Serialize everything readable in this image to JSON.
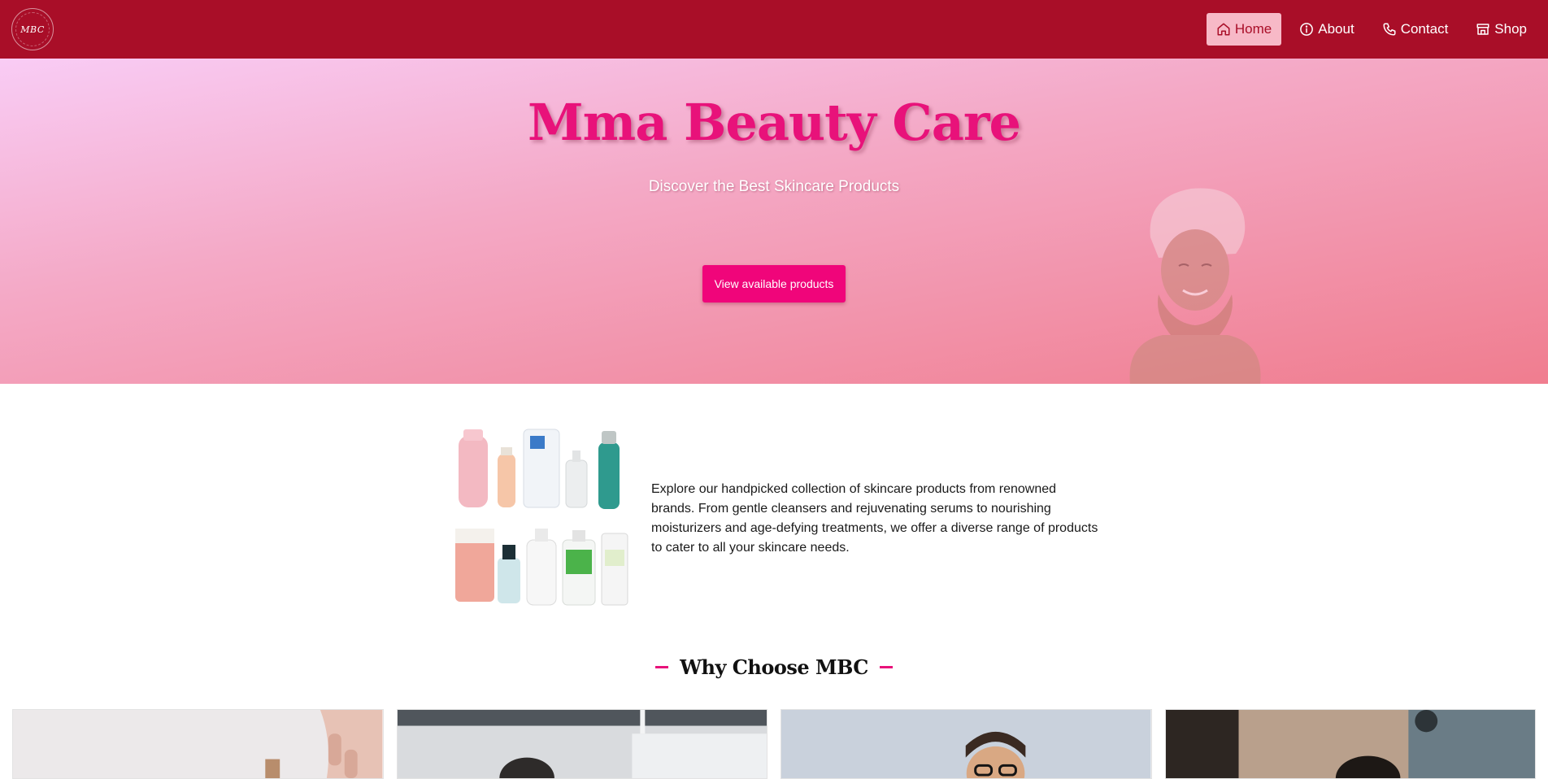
{
  "navbar": {
    "logo_text": "MBC",
    "items": [
      {
        "label": "Home",
        "icon": "home-icon",
        "active": true
      },
      {
        "label": "About",
        "icon": "info-icon",
        "active": false
      },
      {
        "label": "Contact",
        "icon": "phone-icon",
        "active": false
      },
      {
        "label": "Shop",
        "icon": "store-icon",
        "active": false
      }
    ]
  },
  "hero": {
    "title": "Mma Beauty Care",
    "subtitle": "Discover the Best Skincare Products",
    "cta_label": "View available products"
  },
  "about": {
    "text": "Explore our handpicked collection of skincare products from renowned brands. From gentle cleansers and rejuvenating serums to nourishing moisturizers and age-defying treatments, we offer a diverse range of products to cater to all your skincare needs."
  },
  "why": {
    "heading": "Why Choose MBC"
  },
  "colors": {
    "navbar": "#a90e28",
    "accent": "#e8127a",
    "cta": "#f0057a",
    "active_nav_bg": "#f7b9c7"
  }
}
